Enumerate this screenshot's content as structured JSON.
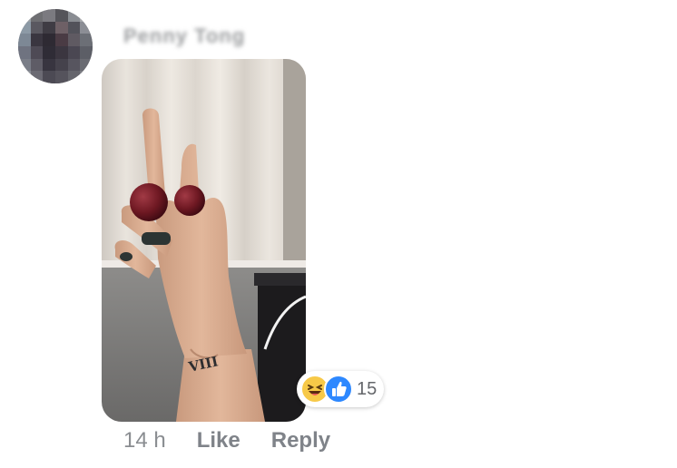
{
  "comment": {
    "author_name": "Penny Tong",
    "timestamp": "14 h",
    "like_label": "Like",
    "reply_label": "Reply",
    "tattoo_text": "VIII",
    "reactions": {
      "icons": [
        "haha-emoji-icon",
        "thumbs-up-icon"
      ],
      "count": "15"
    }
  },
  "colors": {
    "like_blue": "#2d88ff",
    "haha_yellow": "#f7c948",
    "meta_gray": "#7f8389"
  }
}
